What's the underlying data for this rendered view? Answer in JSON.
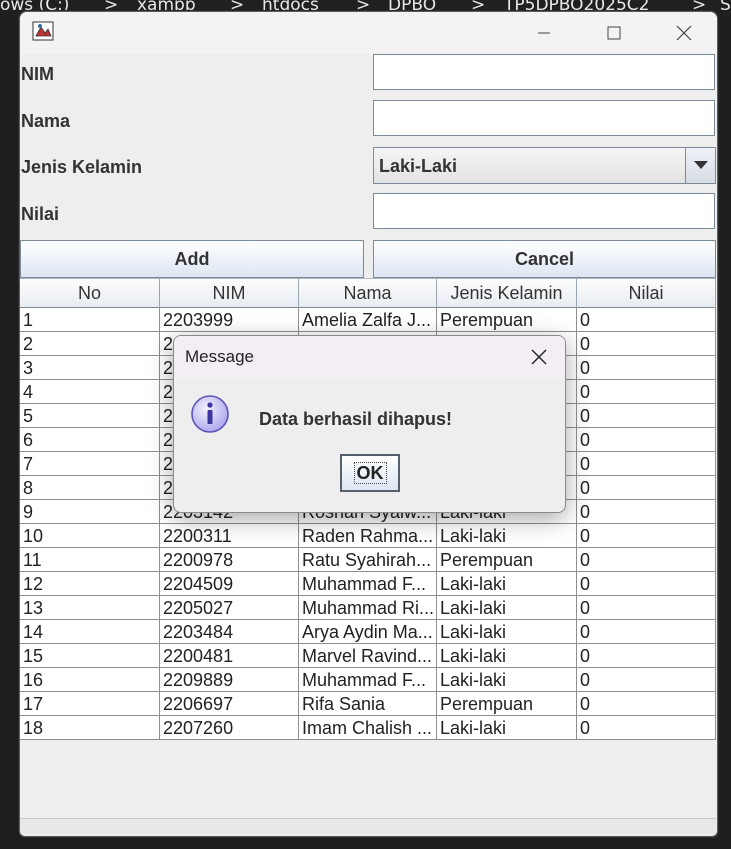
{
  "background": {
    "path_parts": [
      "ows (C:)",
      ">",
      "xampp",
      ">",
      "htdocs",
      ">",
      "DPBO",
      ">",
      "TP5DPBO2025C2",
      ">",
      "S"
    ]
  },
  "form": {
    "nim_label": "NIM",
    "nama_label": "Nama",
    "jenis_kelamin_label": "Jenis Kelamin",
    "nilai_label": "Nilai",
    "nim_value": "",
    "nama_value": "",
    "jenis_kelamin_selected": "Laki-Laki",
    "nilai_value": ""
  },
  "buttons": {
    "add_label": "Add",
    "cancel_label": "Cancel"
  },
  "table": {
    "headers": [
      "No",
      "NIM",
      "Nama",
      "Jenis Kelamin",
      "Nilai"
    ],
    "rows": [
      [
        "1",
        "2203999",
        "Amelia Zalfa J...",
        "Perempuan",
        "0"
      ],
      [
        "2",
        "2",
        "",
        "",
        "0"
      ],
      [
        "3",
        "2",
        "",
        "",
        "0"
      ],
      [
        "4",
        "2",
        "",
        "",
        "0"
      ],
      [
        "5",
        "2",
        "",
        "",
        "0"
      ],
      [
        "6",
        "2",
        "",
        "",
        "0"
      ],
      [
        "7",
        "2",
        "",
        "",
        "0"
      ],
      [
        "8",
        "2",
        "",
        "",
        "0"
      ],
      [
        "9",
        "2203142",
        "Roshan Syalw...",
        "Laki-laki",
        "0"
      ],
      [
        "10",
        "2200311",
        "Raden Rahma...",
        "Laki-laki",
        "0"
      ],
      [
        "11",
        "2200978",
        "Ratu Syahirah...",
        "Perempuan",
        "0"
      ],
      [
        "12",
        "2204509",
        "Muhammad F...",
        "Laki-laki",
        "0"
      ],
      [
        "13",
        "2205027",
        "Muhammad Ri...",
        "Laki-laki",
        "0"
      ],
      [
        "14",
        "2203484",
        "Arya Aydin Ma...",
        "Laki-laki",
        "0"
      ],
      [
        "15",
        "2200481",
        "Marvel Ravind...",
        "Laki-laki",
        "0"
      ],
      [
        "16",
        "2209889",
        "Muhammad F...",
        "Laki-laki",
        "0"
      ],
      [
        "17",
        "2206697",
        "Rifa Sania",
        "Perempuan",
        "0"
      ],
      [
        "18",
        "2207260",
        "Imam Chalish ...",
        "Laki-laki",
        "0"
      ]
    ]
  },
  "dialog": {
    "title": "Message",
    "message": "Data berhasil dihapus!",
    "ok_label": "OK",
    "icon": "info-icon"
  },
  "colors": {
    "window_bg": "#eeeeee",
    "button_gradient_bottom": "#dde6f2",
    "dialog_title_bg": "#f3edf5"
  }
}
